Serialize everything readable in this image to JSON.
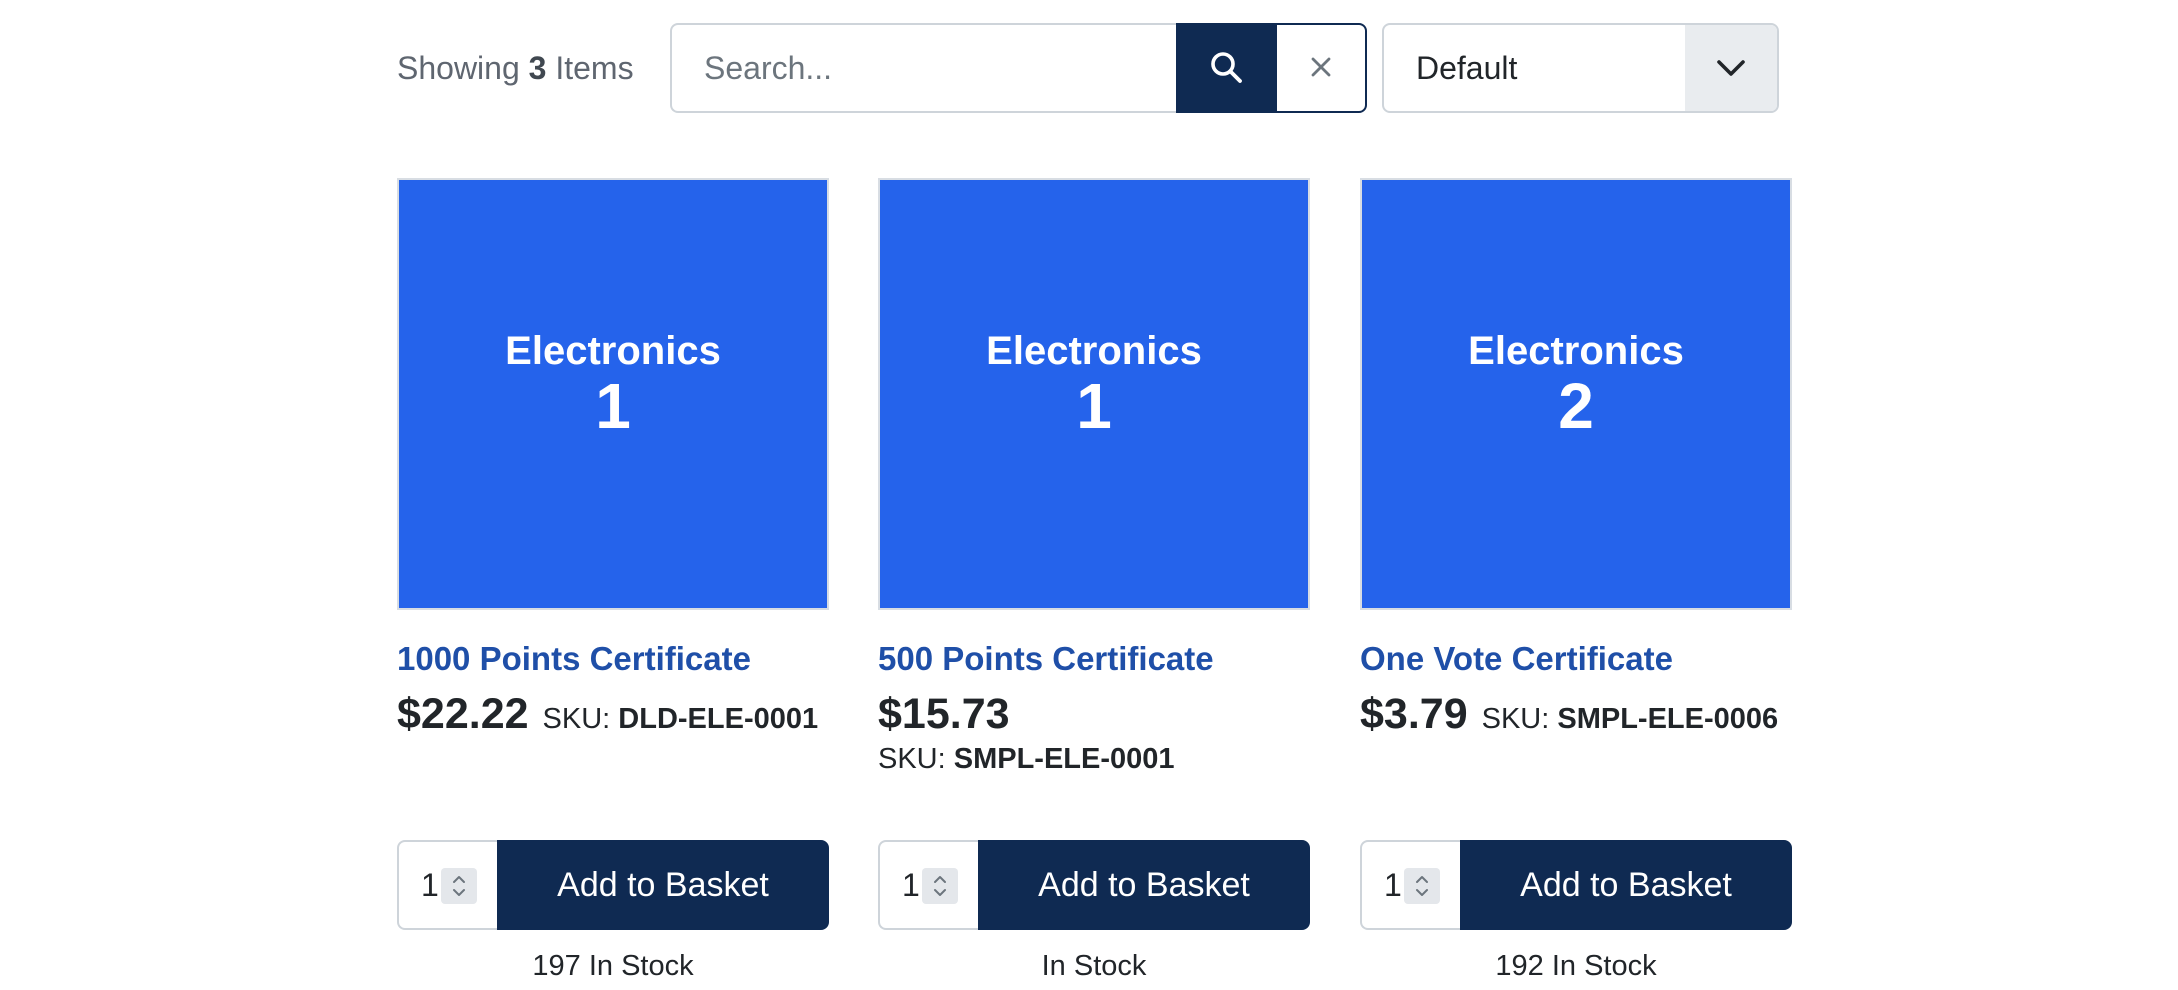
{
  "toolbar": {
    "showing_prefix": "Showing ",
    "count": "3",
    "showing_suffix": " Items",
    "search_placeholder": "Search...",
    "search_value": "",
    "search_icon": "magnifier-icon",
    "clear_icon": "close-icon",
    "sort_value": "Default",
    "sort_icon": "chevron-down-icon"
  },
  "colors": {
    "primary_navy": "#0f2a52",
    "product_blue": "#2563eb",
    "title_link": "#1f4fa8"
  },
  "products": [
    {
      "image_category": "Electronics",
      "image_number": "1",
      "title": "1000 Points Certificate",
      "price": "$22.22",
      "sku_label": "SKU: ",
      "sku": "DLD-ELE-0001",
      "quantity": "1",
      "button_label": "Add to Basket",
      "stock": "197 In Stock"
    },
    {
      "image_category": "Electronics",
      "image_number": "1",
      "title": "500 Points Certificate",
      "price": "$15.73",
      "sku_label": "SKU: ",
      "sku": "SMPL-ELE-0001",
      "quantity": "1",
      "button_label": "Add to Basket",
      "stock": "In Stock"
    },
    {
      "image_category": "Electronics",
      "image_number": "2",
      "title": "One Vote Certificate",
      "price": "$3.79",
      "sku_label": "SKU: ",
      "sku": "SMPL-ELE-0006",
      "quantity": "1",
      "button_label": "Add to Basket",
      "stock": "192 In Stock"
    }
  ]
}
